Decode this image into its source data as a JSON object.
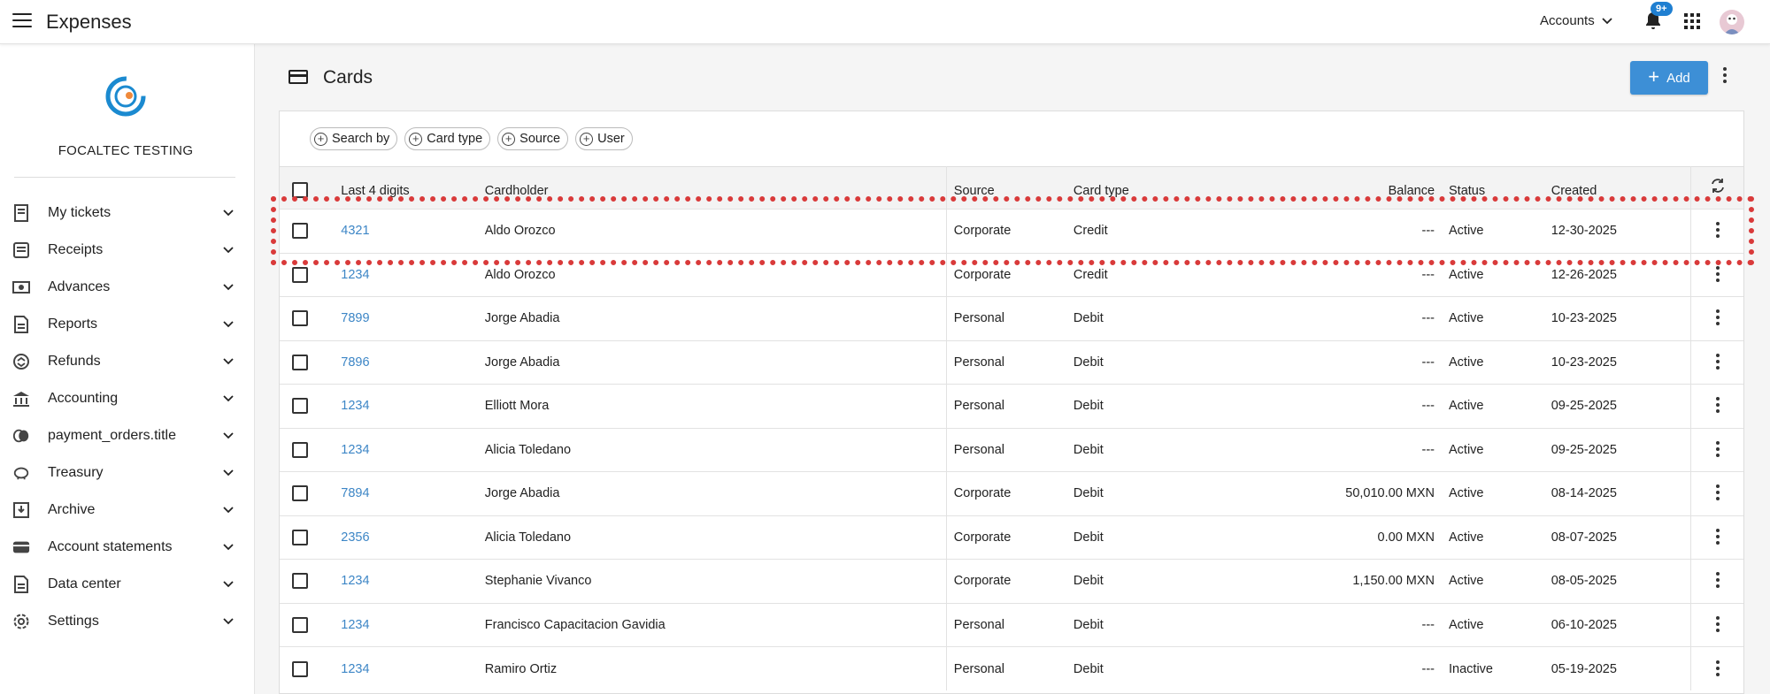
{
  "header": {
    "app_title": "Expenses",
    "accounts_label": "Accounts",
    "notifications_badge": "9+"
  },
  "sidebar": {
    "company_name": "FOCALTEC TESTING",
    "items": [
      {
        "label": "My tickets",
        "icon": "ticket-icon"
      },
      {
        "label": "Receipts",
        "icon": "receipt-icon"
      },
      {
        "label": "Advances",
        "icon": "cash-icon"
      },
      {
        "label": "Reports",
        "icon": "report-icon"
      },
      {
        "label": "Refunds",
        "icon": "refund-icon"
      },
      {
        "label": "Accounting",
        "icon": "bank-icon"
      },
      {
        "label": "payment_orders.title",
        "icon": "coins-icon"
      },
      {
        "label": "Treasury",
        "icon": "piggy-bank-icon"
      },
      {
        "label": "Archive",
        "icon": "archive-icon"
      },
      {
        "label": "Account statements",
        "icon": "wallet-icon"
      },
      {
        "label": "Data center",
        "icon": "database-icon"
      },
      {
        "label": "Settings",
        "icon": "gear-icon"
      }
    ]
  },
  "main": {
    "title": "Cards",
    "add_label": "Add",
    "filters": [
      "Search by",
      "Card type",
      "Source",
      "User"
    ],
    "columns": {
      "digits": "Last 4 digits",
      "holder": "Cardholder",
      "source": "Source",
      "type": "Card type",
      "balance": "Balance",
      "status": "Status",
      "created": "Created"
    },
    "rows": [
      {
        "digits": "4321",
        "holder": "Aldo Orozco",
        "source": "Corporate",
        "type": "Credit",
        "balance": "---",
        "status": "Active",
        "created": "12-30-2025"
      },
      {
        "digits": "1234",
        "holder": "Aldo Orozco",
        "source": "Corporate",
        "type": "Credit",
        "balance": "---",
        "status": "Active",
        "created": "12-26-2025"
      },
      {
        "digits": "7899",
        "holder": "Jorge Abadia",
        "source": "Personal",
        "type": "Debit",
        "balance": "---",
        "status": "Active",
        "created": "10-23-2025"
      },
      {
        "digits": "7896",
        "holder": "Jorge Abadia",
        "source": "Personal",
        "type": "Debit",
        "balance": "---",
        "status": "Active",
        "created": "10-23-2025"
      },
      {
        "digits": "1234",
        "holder": "Elliott Mora",
        "source": "Personal",
        "type": "Debit",
        "balance": "---",
        "status": "Active",
        "created": "09-25-2025"
      },
      {
        "digits": "1234",
        "holder": "Alicia Toledano",
        "source": "Personal",
        "type": "Debit",
        "balance": "---",
        "status": "Active",
        "created": "09-25-2025"
      },
      {
        "digits": "7894",
        "holder": "Jorge Abadia",
        "source": "Corporate",
        "type": "Debit",
        "balance": "50,010.00 MXN",
        "status": "Active",
        "created": "08-14-2025"
      },
      {
        "digits": "2356",
        "holder": "Alicia Toledano",
        "source": "Corporate",
        "type": "Debit",
        "balance": "0.00 MXN",
        "status": "Active",
        "created": "08-07-2025"
      },
      {
        "digits": "1234",
        "holder": "Stephanie Vivanco",
        "source": "Corporate",
        "type": "Debit",
        "balance": "1,150.00 MXN",
        "status": "Active",
        "created": "08-05-2025"
      },
      {
        "digits": "1234",
        "holder": "Francisco Capacitacion Gavidia",
        "source": "Personal",
        "type": "Debit",
        "balance": "---",
        "status": "Active",
        "created": "06-10-2025"
      },
      {
        "digits": "1234",
        "holder": "Ramiro Ortiz",
        "source": "Personal",
        "type": "Debit",
        "balance": "---",
        "status": "Inactive",
        "created": "05-19-2025"
      }
    ]
  },
  "colors": {
    "accent": "#3d8fd6",
    "link": "#3d86c6",
    "highlight": "#d93a3a"
  }
}
